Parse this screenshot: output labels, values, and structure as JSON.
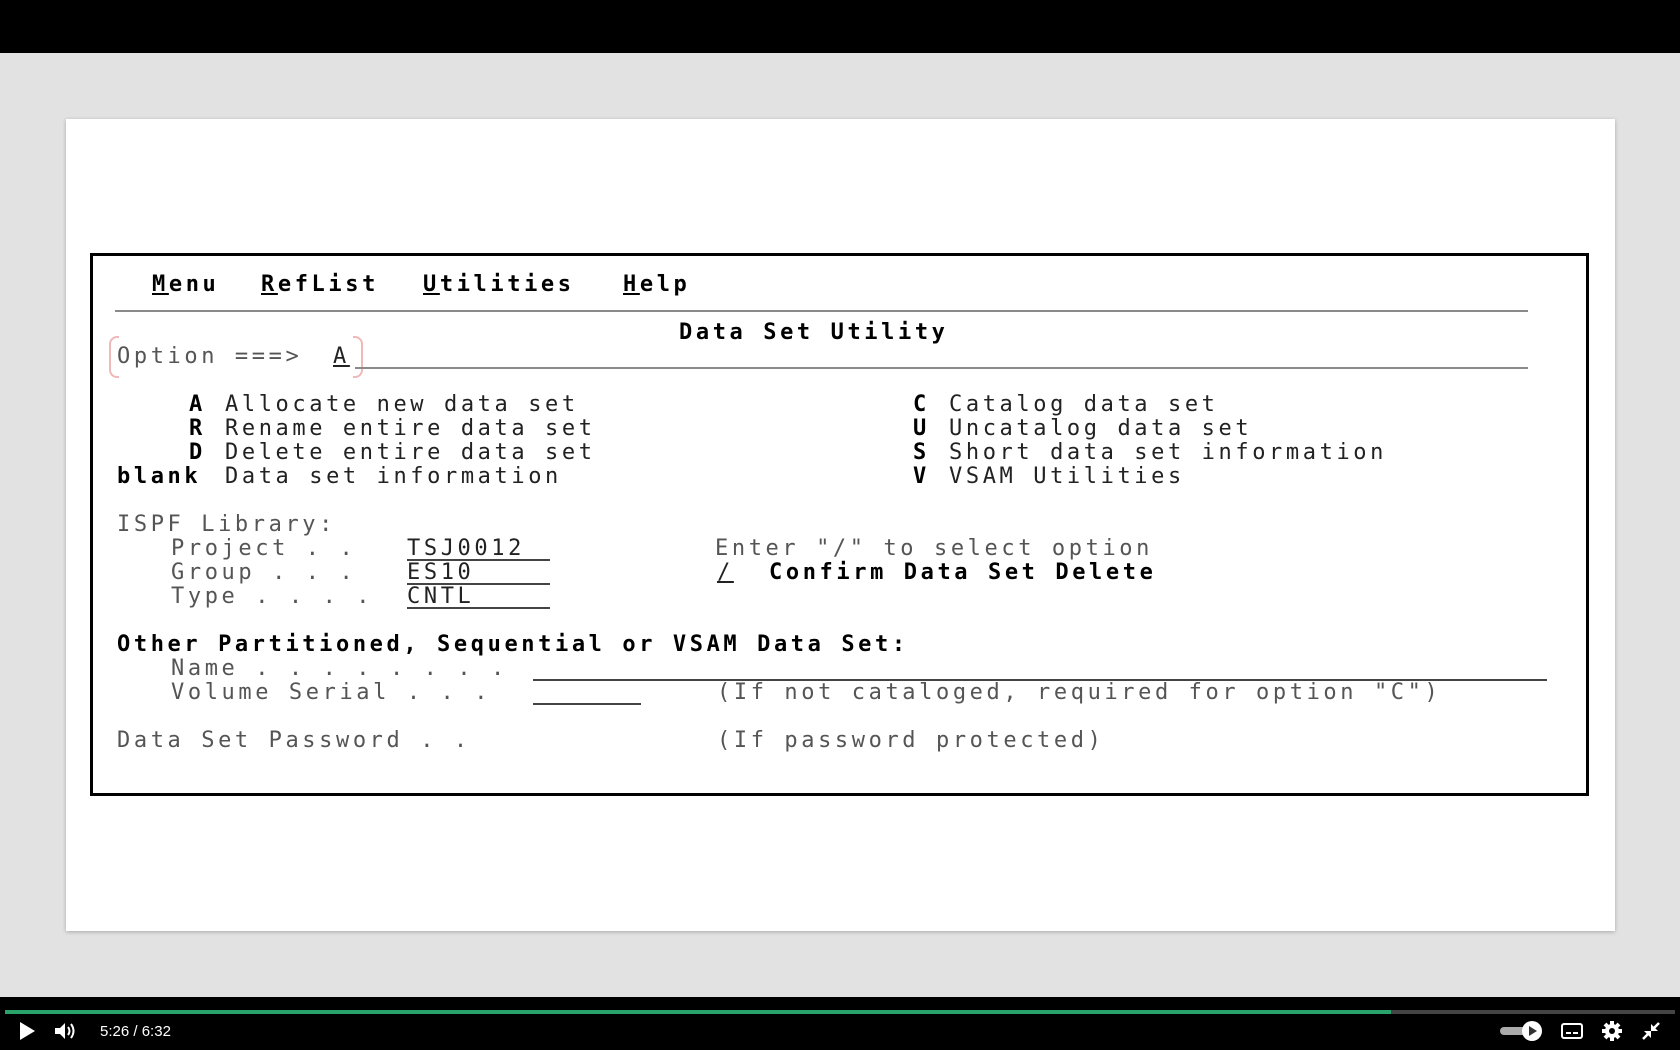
{
  "menu": {
    "items": [
      {
        "first": "M",
        "rest": "enu"
      },
      {
        "first": "R",
        "rest": "efList"
      },
      {
        "first": "U",
        "rest": "tilities"
      },
      {
        "first": "H",
        "rest": "elp"
      }
    ]
  },
  "panel": {
    "title": "Data Set Utility",
    "option_label": "Option ===>",
    "option_value": "A"
  },
  "options_left": [
    {
      "key": "A",
      "label": "Allocate new data set"
    },
    {
      "key": "R",
      "label": "Rename entire data set"
    },
    {
      "key": "D",
      "label": "Delete entire data set"
    },
    {
      "key": "blank",
      "label": "Data set information"
    }
  ],
  "options_right": [
    {
      "key": "C",
      "label": "Catalog data set"
    },
    {
      "key": "U",
      "label": "Uncatalog data set"
    },
    {
      "key": "S",
      "label": "Short data set information"
    },
    {
      "key": "V",
      "label": "VSAM Utilities"
    }
  ],
  "library": {
    "heading": "ISPF Library:",
    "project_label": "Project . .",
    "project_value": "TSJ0012",
    "group_label": "Group . . .",
    "group_value": "ES10",
    "type_label": "Type . . . .",
    "type_value": "CNTL"
  },
  "select_hint": "Enter \"/\" to select option",
  "confirm": {
    "mark": "/",
    "label": "Confirm Data Set Delete"
  },
  "other": {
    "heading": "Other Partitioned, Sequential or VSAM Data Set:",
    "name_label": "Name . . . . . . . .",
    "volume_label": "Volume Serial . . .",
    "volume_note": "(If not cataloged, required for option \"C\")"
  },
  "password": {
    "label": "Data Set Password . .",
    "note": "(If password protected)"
  },
  "player": {
    "current_time": "5:26",
    "separator": "/",
    "duration": "6:32",
    "progress": 0.83,
    "colors": {
      "progress": "#2aa36a",
      "bar": "#000000"
    }
  }
}
